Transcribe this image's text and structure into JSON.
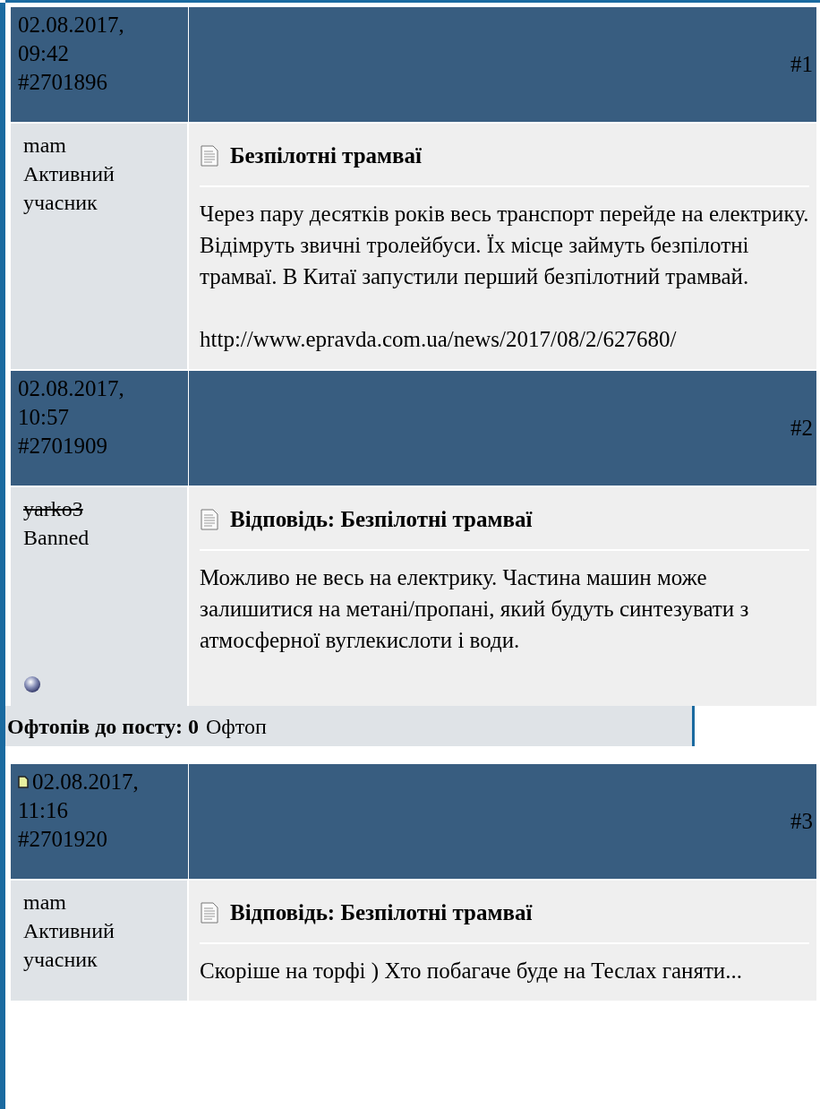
{
  "posts": [
    {
      "date": "02.08.2017,",
      "time": "09:42",
      "post_id": "#2701896",
      "number": "#1",
      "new": false,
      "author": {
        "name": "mam",
        "rank": "Активний учасник",
        "banned": false
      },
      "status_icon": false,
      "title": "Безпілотні трамваї",
      "body": [
        "Через пару десятків років весь транспорт перейде на електрику. Відімруть звичні тролейбуси. Їх місце займуть безпілотні трамваї. В Китаї запустили перший безпілотний трамвай.",
        "http://www.epravda.com.ua/news/2017/08/2/627680/"
      ]
    },
    {
      "date": "02.08.2017,",
      "time": "10:57",
      "post_id": "#2701909",
      "number": "#2",
      "new": false,
      "author": {
        "name": "yarko3",
        "rank": "Banned",
        "banned": true
      },
      "status_icon": true,
      "title": "Відповідь: Безпілотні трамваї",
      "body": [
        "Можливо не весь на електрику. Частина машин може залишитися на метані/пропані, який будуть синтезувати з атмосферної вуглекислоти і води."
      ],
      "offtopic": {
        "label": "Офтопів до посту: 0",
        "link": "Офтоп"
      }
    },
    {
      "date": "02.08.2017,",
      "time": "11:16",
      "post_id": "#2701920",
      "number": "#3",
      "new": true,
      "author": {
        "name": "mam",
        "rank": "Активний учасник",
        "banned": false
      },
      "status_icon": false,
      "title": "Відповідь: Безпілотні трамваї",
      "body": [
        "Скоріше на торфі ) Хто побагаче буде на Теслах ганяти..."
      ]
    }
  ]
}
